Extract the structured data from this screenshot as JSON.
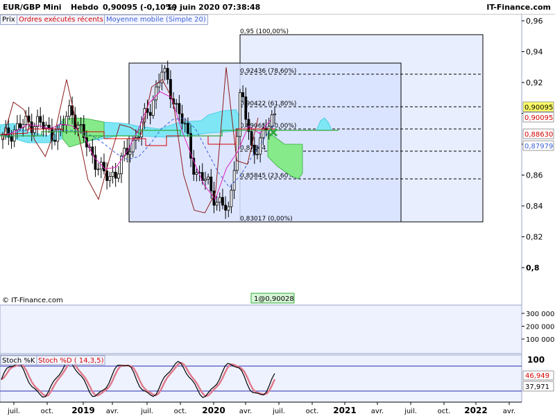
{
  "header": {
    "symbol": "EUR/GBP Mini",
    "period": "Hebdo",
    "quote": "0,90095 (-0,10%)",
    "datetime": "19 juin 2020 07:38:48",
    "site": "IT-Finance.com"
  },
  "legend": {
    "price": "Prix",
    "orders": "Ordres exécutés récents",
    "ma": "Moyenne mobile (Simple 20)"
  },
  "watermark": "© IT-Finance.com",
  "cursor_label": "1@0,90028",
  "colors": {
    "accent_red": "#d40000",
    "ma_blue": "#3a5fd8",
    "fib_box": "#d8e2ff",
    "kumo_cyan": "#7ee6f4",
    "kumo_green": "#86ea8a",
    "volume_bg": "#eef2ff"
  },
  "price_axis": {
    "ticks": [
      "0,96",
      "0,94",
      "0,92",
      "0,9",
      "0,88",
      "0,86",
      "0,84",
      "0,82",
      "0,8"
    ],
    "badges": [
      "0,90095",
      "0,90095",
      "0,88630",
      "0,87979"
    ]
  },
  "volume_axis": {
    "ticks": [
      "300 000",
      "200 000",
      "100 000"
    ]
  },
  "stoch": {
    "label_k": "Stoch %K",
    "label_d": "Stoch %D ( 14,3,5)",
    "axis_top": "100",
    "value_d": "46,949",
    "value_k": "37,971"
  },
  "time_axis": [
    "juil.",
    "oct.",
    "2019",
    "avr.",
    "juil.",
    "oct.",
    "2020",
    "avr.",
    "juil.",
    "oct.",
    "2021",
    "avr.",
    "juil.",
    "oct.",
    "2022",
    "avr."
  ],
  "fib_levels": [
    "0,95 (100,00%)",
    "0,92436 (78,60%)",
    "0,90422 (61,80%)",
    "0,89065 (50,00%)",
    "0,87504 (38,20%)",
    "0,85845 (23,60%)",
    "0,83017 (0,00%)"
  ],
  "chart_data": {
    "type": "line",
    "title": "EUR/GBP Mini Hebdo",
    "xlabel": "",
    "ylabel": "",
    "ylim": [
      0.78,
      0.97
    ],
    "x": [
      "2018-06",
      "2018-07",
      "2018-08",
      "2018-09",
      "2018-10",
      "2018-11",
      "2018-12",
      "2019-01",
      "2019-02",
      "2019-03",
      "2019-04",
      "2019-05",
      "2019-06",
      "2019-07",
      "2019-08",
      "2019-09",
      "2019-10",
      "2019-11",
      "2019-12",
      "2020-01",
      "2020-02",
      "2020-03",
      "2020-04",
      "2020-05",
      "2020-06"
    ],
    "series": [
      {
        "name": "Prix",
        "values": [
          0.883,
          0.89,
          0.893,
          0.895,
          0.888,
          0.887,
          0.904,
          0.885,
          0.872,
          0.858,
          0.862,
          0.875,
          0.889,
          0.903,
          0.928,
          0.911,
          0.892,
          0.862,
          0.855,
          0.843,
          0.835,
          0.915,
          0.875,
          0.885,
          0.901
        ]
      },
      {
        "name": "Moyenne mobile (Simple 20)",
        "values": [
          0.886,
          0.888,
          0.889,
          0.89,
          0.89,
          0.889,
          0.889,
          0.888,
          0.885,
          0.88,
          0.874,
          0.87,
          0.872,
          0.88,
          0.89,
          0.896,
          0.897,
          0.89,
          0.876,
          0.862,
          0.852,
          0.86,
          0.872,
          0.883,
          0.893
        ]
      }
    ],
    "fibonacci": {
      "high": 0.95,
      "low": 0.83017,
      "levels": [
        0.95,
        0.92436,
        0.90422,
        0.89065,
        0.87504,
        0.85845,
        0.83017
      ]
    },
    "stochastic": {
      "k": 37.971,
      "d": 46.949
    },
    "grid": false,
    "legend_placement": "top-left"
  }
}
